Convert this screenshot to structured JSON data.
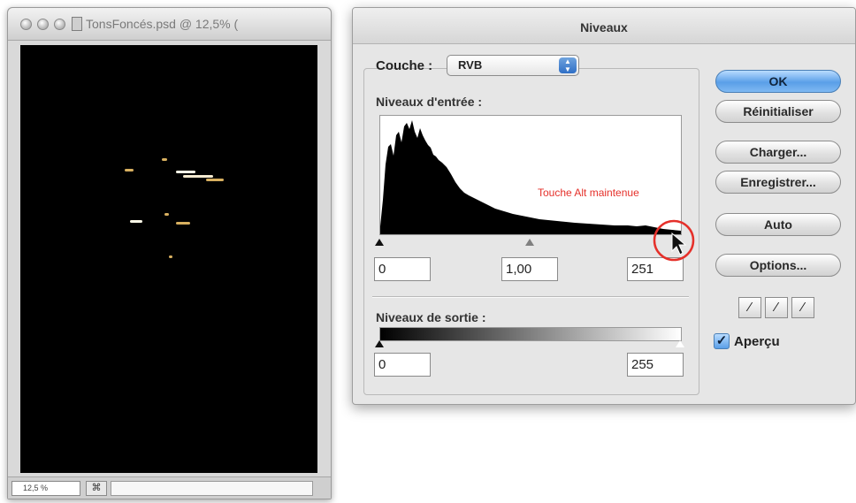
{
  "document_window": {
    "title": "TonsFoncés.psd @ 12,5% (",
    "zoom": "12,5 %",
    "status_icon": "⌘"
  },
  "levels_dialog": {
    "title": "Niveaux",
    "channel_label": "Couche :",
    "channel_value": "RVB",
    "input_levels_label": "Niveaux d'entrée :",
    "input_black": "0",
    "input_gamma": "1,00",
    "input_white": "251",
    "output_levels_label": "Niveaux de sortie :",
    "output_black": "0",
    "output_white": "255",
    "buttons": {
      "ok": "OK",
      "reset": "Réinitialiser",
      "load": "Charger...",
      "save": "Enregistrer...",
      "auto": "Auto",
      "options": "Options..."
    },
    "preview_label": "Aperçu",
    "preview_checked": true
  },
  "annotation": {
    "text": "Touche Alt maintenue",
    "color": "#e5302a"
  },
  "colors": {
    "ok_button": "#5a9fe8",
    "annotation_red": "#e5302a"
  }
}
